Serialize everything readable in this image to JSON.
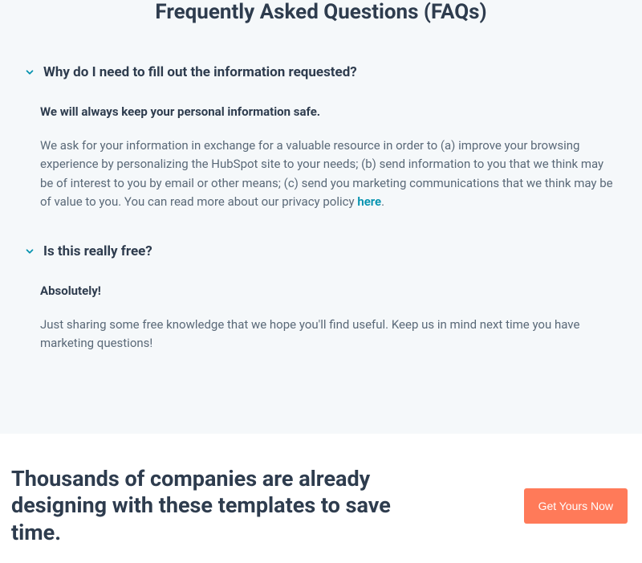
{
  "faq": {
    "title": "Frequently Asked Questions (FAQs)",
    "items": [
      {
        "question": "Why do I need to fill out the information requested?",
        "answer_bold": "We will always keep your personal information safe.",
        "answer_body_pre": "We ask for your information in exchange for a valuable resource in order to (a) improve your browsing experience by personalizing the HubSpot site to your needs; (b) send information to you that we think may be of interest to you by email or other means; (c) send you marketing communications that we think may be of value to you. You can read more about our privacy policy ",
        "answer_link": "here",
        "answer_body_post": "."
      },
      {
        "question": "Is this really free?",
        "answer_bold": "Absolutely!",
        "answer_body_pre": "Just sharing some free knowledge that we hope you'll find useful. Keep us in mind next time you have marketing questions!",
        "answer_link": "",
        "answer_body_post": ""
      }
    ]
  },
  "bottom": {
    "headline": "Thousands of companies are already designing with these templates to save time.",
    "cta_label": "Get Yours Now"
  },
  "colors": {
    "accent_link": "#0091ae",
    "cta_bg": "#ff7a59"
  }
}
